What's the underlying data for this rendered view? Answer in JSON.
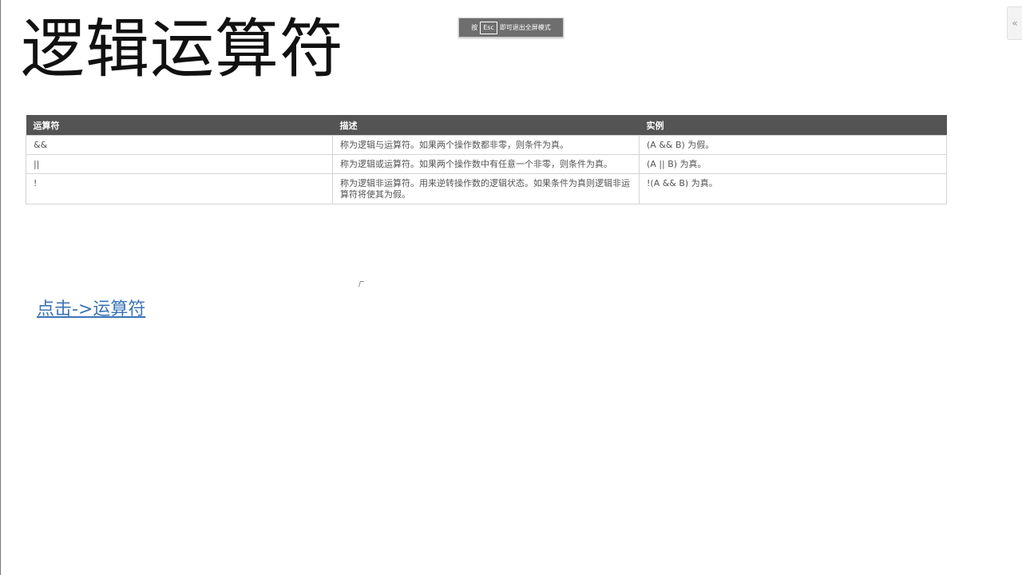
{
  "page": {
    "title": "逻辑运算符"
  },
  "fullscreen_hint": {
    "prefix": "按",
    "key": "Esc",
    "suffix": "即可退出全屏模式"
  },
  "side_tab": {
    "icon": "double-chevron-left-icon",
    "glyph": "«"
  },
  "table": {
    "headers": [
      "运算符",
      "描述",
      "实例"
    ],
    "rows": [
      {
        "operator": "&&",
        "description": "称为逻辑与运算符。如果两个操作数都非零，则条件为真。",
        "example": "(A && B) 为假。"
      },
      {
        "operator": "||",
        "description": "称为逻辑或运算符。如果两个操作数中有任意一个非零，则条件为真。",
        "example": "(A || B) 为真。"
      },
      {
        "operator": "!",
        "description": "称为逻辑非运算符。用来逆转操作数的逻辑状态。如果条件为真则逻辑非运算符将使其为假。",
        "example": "!(A && B) 为真。"
      }
    ]
  },
  "link": {
    "label": "点击->运算符"
  },
  "colors": {
    "header_bg": "#555455",
    "link": "#3b74b8",
    "text": "#555555"
  }
}
